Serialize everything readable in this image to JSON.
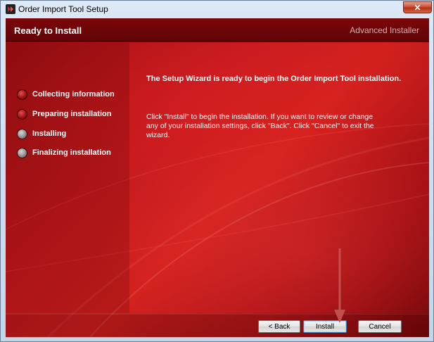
{
  "window": {
    "title": "Order Import Tool Setup",
    "close_glyph": "✕"
  },
  "header": {
    "title": "Ready to Install",
    "brand": "Advanced Installer"
  },
  "steps": [
    {
      "label": "Collecting information",
      "state": "done"
    },
    {
      "label": "Preparing installation",
      "state": "done"
    },
    {
      "label": "Installing",
      "state": "pending"
    },
    {
      "label": "Finalizing installation",
      "state": "pending"
    }
  ],
  "content": {
    "heading": "The Setup Wizard is ready to begin the Order Import Tool installation.",
    "body": "Click \"Install\" to begin the installation.  If you want to review or change any of your installation settings, click \"Back\".  Click \"Cancel\" to exit the wizard."
  },
  "buttons": {
    "back": "< Back",
    "install": "Install",
    "cancel": "Cancel"
  },
  "colors": {
    "theme_red": "#c51a1e",
    "arrow": "#c0504d"
  }
}
